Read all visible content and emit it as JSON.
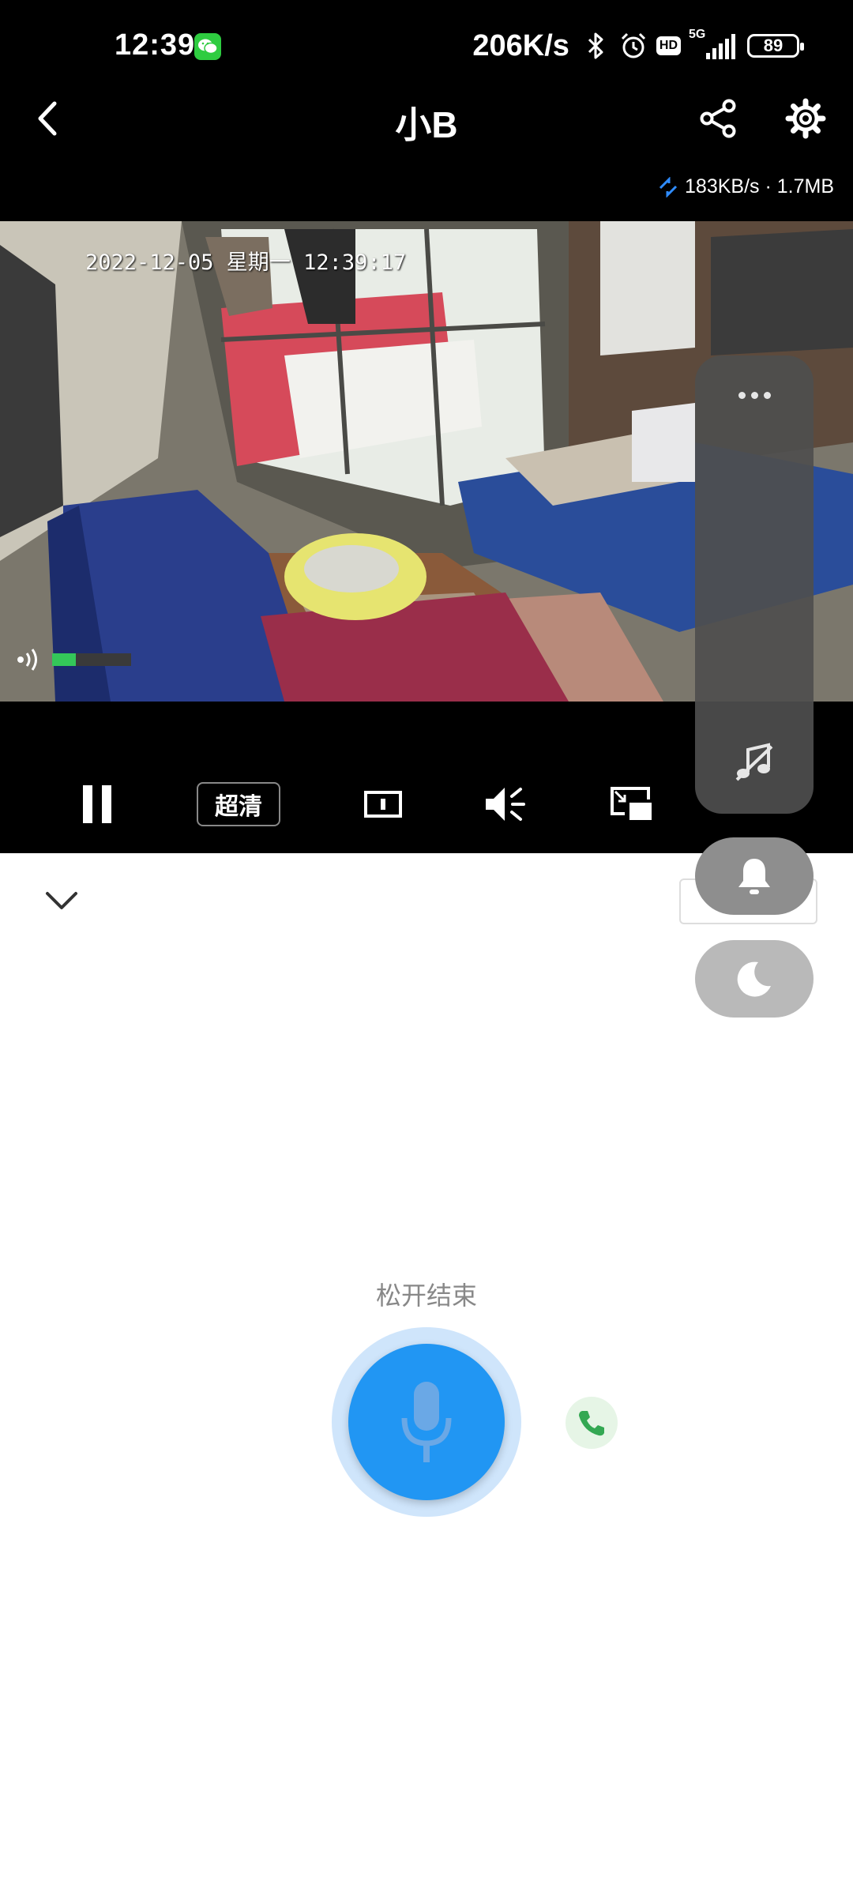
{
  "status_bar": {
    "time": "12:39",
    "net_speed": "206K/s",
    "network": "5G",
    "hd": "HD",
    "battery": "89",
    "icons": [
      "wechat-icon",
      "bluetooth-icon",
      "alarm-icon",
      "hd-icon",
      "signal-icon",
      "battery-icon"
    ]
  },
  "header": {
    "title": "小B",
    "back_icon": "chevron-left-icon",
    "share_icon": "share-icon",
    "settings_icon": "gear-icon"
  },
  "stream": {
    "rate": "183KB/s · 1.7MB",
    "timestamp": "2022-12-05 星期一 12:39:17",
    "audio_level": 0.3
  },
  "controls": {
    "quality": "超清",
    "icons": [
      "pause-icon",
      "quality-button",
      "aspect-ratio-icon",
      "speaker-icon",
      "picture-in-picture-icon"
    ]
  },
  "side_panel": {
    "icons": [
      "more-icon",
      "music-off-icon",
      "bell-icon",
      "moon-icon"
    ]
  },
  "talk": {
    "release_text": "松开结束",
    "mic_icon": "microphone-icon",
    "call_icon": "phone-icon"
  },
  "colors": {
    "accent_blue": "#2196f3",
    "mic_ring": "#cfe5fb",
    "call_green": "#34a853",
    "audio_level_green": "#34c759"
  }
}
